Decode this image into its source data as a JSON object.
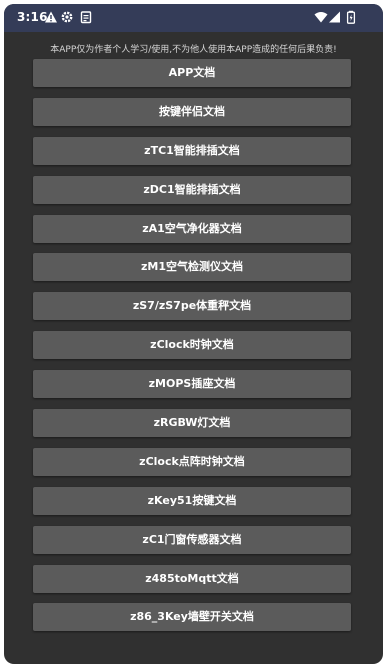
{
  "status_bar": {
    "time": "3:16",
    "icons": [
      "warning-icon",
      "settings-icon",
      "clipboard-icon",
      "wifi-icon",
      "cellular-signal-icon",
      "battery-icon"
    ],
    "background": "#343c58"
  },
  "notice": "本APP仅为作者个人学习/使用,不为他人使用本APP造成的任何后果负责!",
  "buttons": [
    "APP文档",
    "按键伴侣文档",
    "zTC1智能排插文档",
    "zDC1智能排插文档",
    "zA1空气净化器文档",
    "zM1空气检测仪文档",
    "zS7/zS7pe体重秤文档",
    "zClock时钟文档",
    "zMOPS插座文档",
    "zRGBW灯文档",
    "zClock点阵时钟文档",
    "zKey51按键文档",
    "zC1门窗传感器文档",
    "z485toMqtt文档",
    "z86_3Key墙壁开关文档"
  ],
  "colors": {
    "background": "#303030",
    "button": "#5b5b5b",
    "button_text": "#ffffff",
    "status_bar": "#343c58"
  }
}
